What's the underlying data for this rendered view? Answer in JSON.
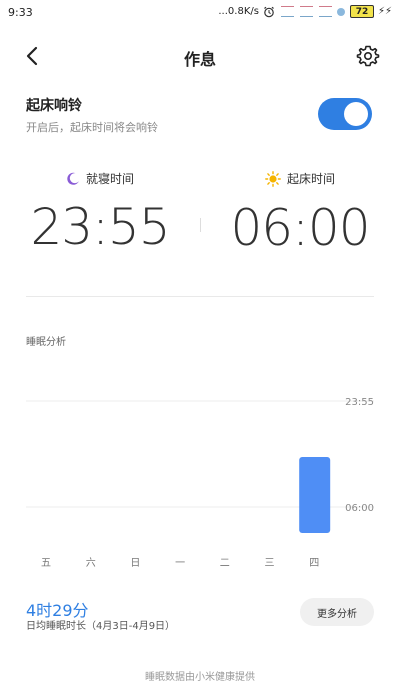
{
  "status_bar": {
    "time": "9:33",
    "network_speed": "...0.8K/s",
    "battery": "72",
    "charging_glyph": "⚡⚡"
  },
  "header": {
    "title": "作息",
    "back_icon": "back-arrow-icon",
    "settings_icon": "gear-icon"
  },
  "alarm": {
    "title": "起床响铃",
    "subtitle": "开启后，起床时间将会响铃",
    "enabled": true
  },
  "bedtime": {
    "label": "就寝时间",
    "value": "23:55",
    "icon": "moon-icon"
  },
  "waketime": {
    "label": "起床时间",
    "value": "06:00",
    "icon": "sun-icon"
  },
  "analysis": {
    "title": "睡眠分析"
  },
  "chart_data": {
    "type": "bar",
    "categories": [
      "五",
      "六",
      "日",
      "一",
      "二",
      "三",
      "四"
    ],
    "ytick_labels": [
      "23:55",
      "06:00"
    ],
    "series": [
      {
        "bars": [
          null,
          null,
          null,
          null,
          null,
          null,
          {
            "start": "23:55",
            "end": "06:00"
          }
        ]
      }
    ],
    "color": "#4f8ef5",
    "grid": true
  },
  "summary": {
    "value": "4时29分",
    "label": "日均睡眠时长（4月3日-4月9日）",
    "more_button": "更多分析"
  },
  "footer": {
    "note": "睡眠数据由小米健康提供"
  },
  "colors": {
    "accent": "#2f7fe2",
    "bar": "#4f8ef5"
  }
}
